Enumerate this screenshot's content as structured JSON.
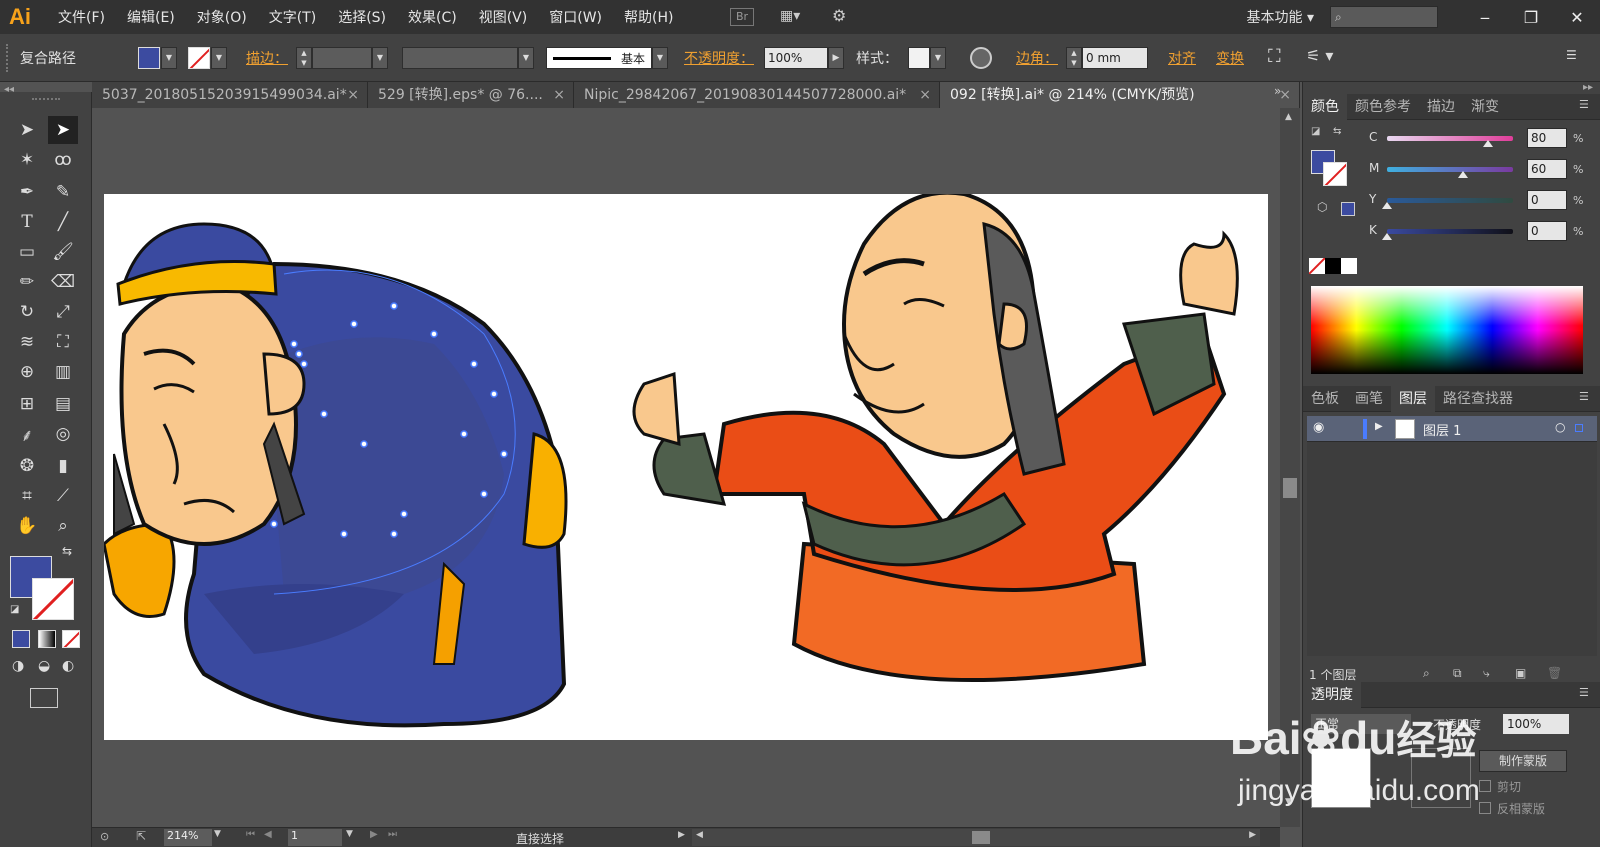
{
  "app": {
    "logo": "Ai",
    "workspace": "基本功能"
  },
  "menu": [
    "文件(F)",
    "编辑(E)",
    "对象(O)",
    "文字(T)",
    "选择(S)",
    "效果(C)",
    "视图(V)",
    "窗口(W)",
    "帮助(H)"
  ],
  "menu_icons": {
    "bridge": "Br"
  },
  "control": {
    "object_type": "复合路径",
    "stroke_label": "描边：",
    "stroke_style": "基本",
    "opacity_label": "不透明度：",
    "opacity_value": "100%",
    "style_label": "样式：",
    "corner_label": "边角：",
    "corner_value": "0 mm",
    "align_link": "对齐",
    "transform_link": "变换",
    "fill_color": "#3c4ba0"
  },
  "tabs": [
    {
      "label": "5037_20180515203915499034.ai*",
      "close": "×"
    },
    {
      "label": "529 [转换].eps* @ 76....",
      "close": "×"
    },
    {
      "label": "Nipic_29842067_20190830144507728000.ai*",
      "close": "×"
    },
    {
      "label": "092 [转换].ai* @ 214% (CMYK/预览)",
      "close": "×"
    }
  ],
  "color_panel": {
    "tabs": [
      "颜色",
      "颜色参考",
      "描边",
      "渐变"
    ],
    "sliders": [
      {
        "label": "C",
        "value": "80",
        "fraction": 0.8
      },
      {
        "label": "M",
        "value": "60",
        "fraction": 0.6
      },
      {
        "label": "Y",
        "value": "0",
        "fraction": 0.0
      },
      {
        "label": "K",
        "value": "0",
        "fraction": 0.0
      }
    ],
    "percent": "%"
  },
  "layers_panel": {
    "tabs": [
      "色板",
      "画笔",
      "图层",
      "路径查找器"
    ],
    "layer_name": "图层 1",
    "layer_count": "1 个图层"
  },
  "transparency_panel": {
    "title": "透明度",
    "blend_mode": "正常",
    "opacity_label": "不透明度",
    "opacity_value": "100%",
    "make_mask": "制作蒙版",
    "clip": "剪切",
    "invert_mask": "反相蒙版"
  },
  "status": {
    "zoom": "214%",
    "page": "1",
    "tool_name": "直接选择"
  },
  "watermark": {
    "brand": "Bai",
    "brand2": "du",
    "jingyan": "经验",
    "url": "jingyan.baidu.com"
  }
}
